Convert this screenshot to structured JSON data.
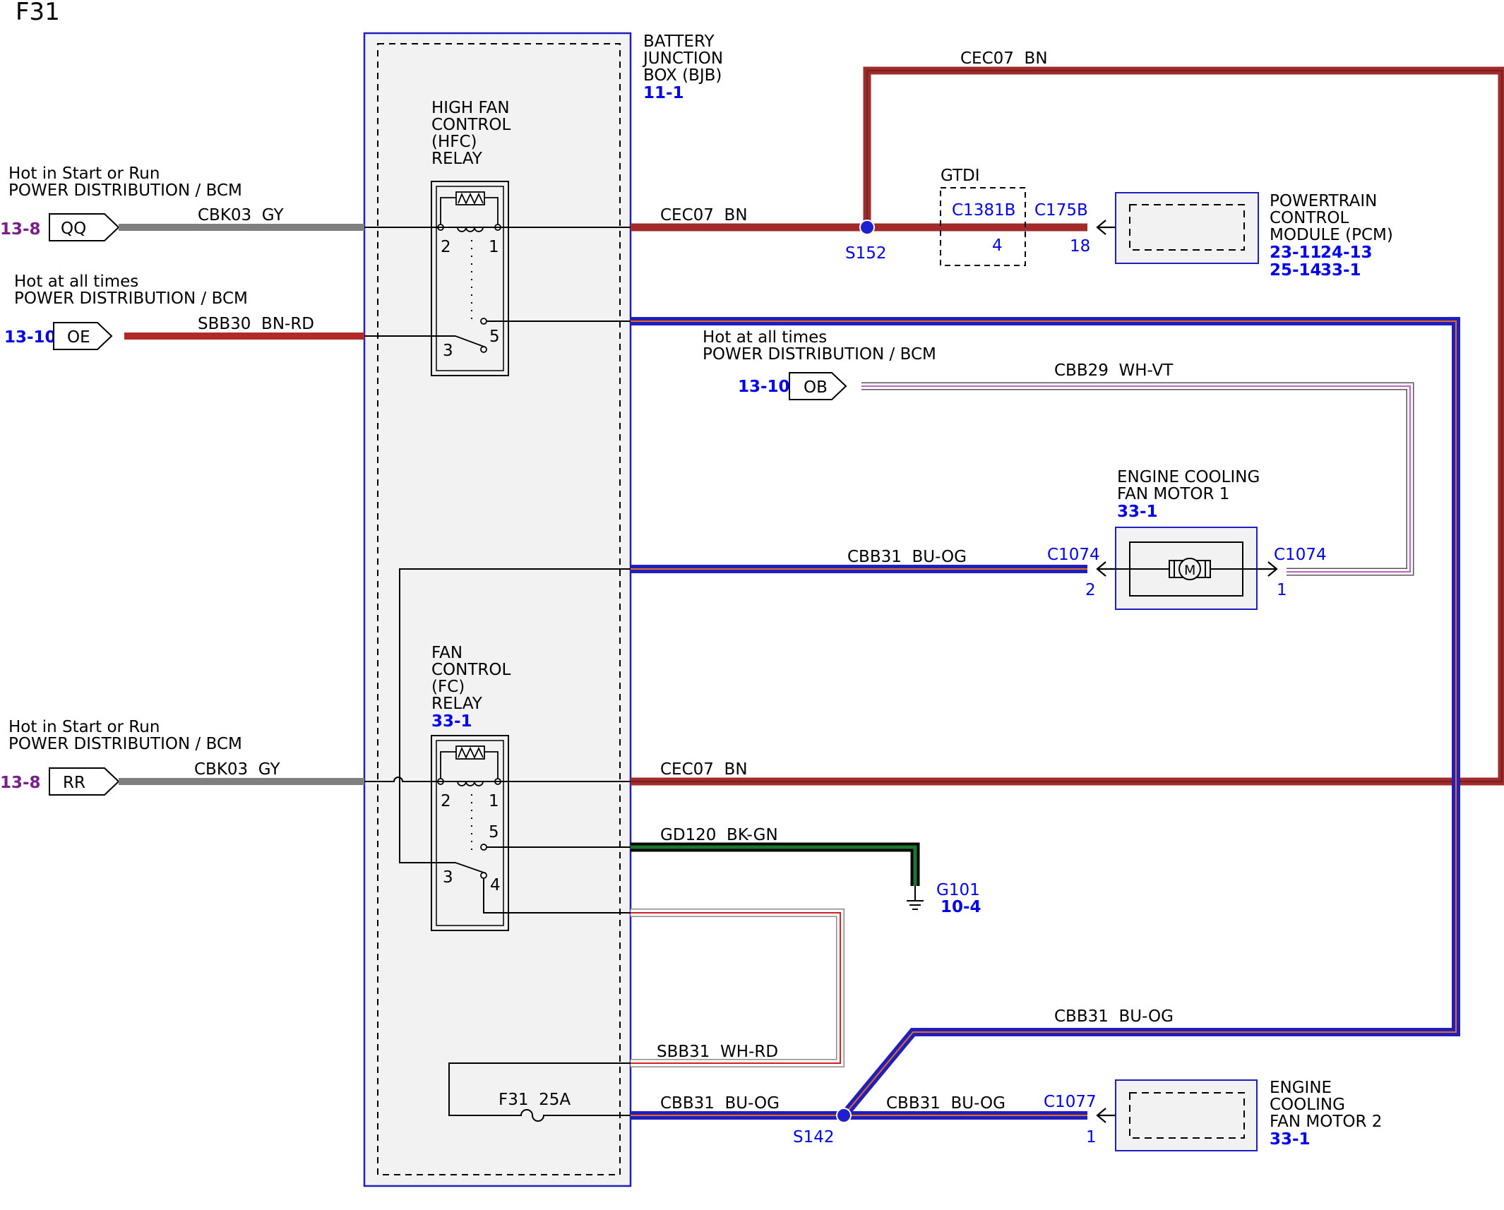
{
  "page": {
    "title": "F31"
  },
  "colors": {
    "brown": "#a12a2a",
    "blue": "#1f1fbf",
    "gray": "#7f7f7f",
    "red": "#cc2222",
    "green": "#1b5e20",
    "link_blue": "#0000ee",
    "link_purple": "#7a1e8c",
    "box_fill": "#f2f2f2"
  },
  "bjb": {
    "name_lines": [
      "BATTERY",
      "JUNCTION",
      "BOX (BJB)"
    ],
    "ref": "11-1"
  },
  "hfc": {
    "name_lines": [
      "HIGH FAN",
      "CONTROL",
      "(HFC)",
      "RELAY"
    ],
    "pins": {
      "p2": "2",
      "p1": "1",
      "p3": "3",
      "p5": "5"
    }
  },
  "fc": {
    "name_lines": [
      "FAN",
      "CONTROL",
      "(FC)",
      "RELAY"
    ],
    "ref": "33-1",
    "pins": {
      "p2": "2",
      "p1": "1",
      "p5": "5",
      "p3": "3",
      "p4": "4"
    }
  },
  "sources": {
    "qq": {
      "desc1": "Hot in Start or Run",
      "desc2": "POWER DISTRIBUTION / BCM",
      "ref": "13-8",
      "code": "QQ",
      "wire": "CBK03  GY"
    },
    "oe": {
      "desc1": "Hot at all times",
      "desc2": "POWER DISTRIBUTION / BCM",
      "ref": "13-10",
      "code": "OE",
      "wire": "SBB30  BN-RD"
    },
    "ob": {
      "desc1": "Hot at all times",
      "desc2": "POWER DISTRIBUTION / BCM",
      "ref": "13-10",
      "code": "OB",
      "wire": "CBB29  WH-VT"
    },
    "rr": {
      "desc1": "Hot in Start or Run",
      "desc2": "POWER DISTRIBUTION / BCM",
      "ref": "13-8",
      "code": "RR",
      "wire": "CBK03  GY"
    }
  },
  "wires": {
    "cec07_top": "CEC07  BN",
    "cec07_hfc": "CEC07  BN",
    "cec07_fc": "CEC07  BN",
    "cbb31_motor1": "CBB31  BU-OG",
    "gd120": "GD120  BK-GN",
    "sbb31": "SBB31  WH-RD",
    "cbb31_fuse": "CBB31  BU-OG",
    "cbb31_motor2": "CBB31  BU-OG",
    "cbb31_loop": "CBB31  BU-OG"
  },
  "splices": {
    "s152": "S152",
    "s142": "S142"
  },
  "gtdi": {
    "label": "GTDI",
    "connector": "C1381B",
    "pin": "4"
  },
  "pcm": {
    "connector": "C175B",
    "pin": "18",
    "name_lines": [
      "POWERTRAIN",
      "CONTROL",
      "MODULE (PCM)"
    ],
    "refs": [
      "23-11",
      "24-13",
      "25-14",
      "33-1"
    ]
  },
  "motor1": {
    "name_lines": [
      "ENGINE COOLING",
      "FAN MOTOR 1"
    ],
    "ref": "33-1",
    "conn_left": "C1074",
    "pin_left": "2",
    "conn_right": "C1074",
    "pin_right": "1",
    "symbol": "M"
  },
  "motor2": {
    "name_lines": [
      "ENGINE",
      "COOLING",
      "FAN MOTOR 2"
    ],
    "ref": "33-1",
    "conn": "C1077",
    "pin": "1"
  },
  "ground": {
    "name": "G101",
    "ref": "10-4"
  },
  "fuse": {
    "label": "F31  25A"
  }
}
